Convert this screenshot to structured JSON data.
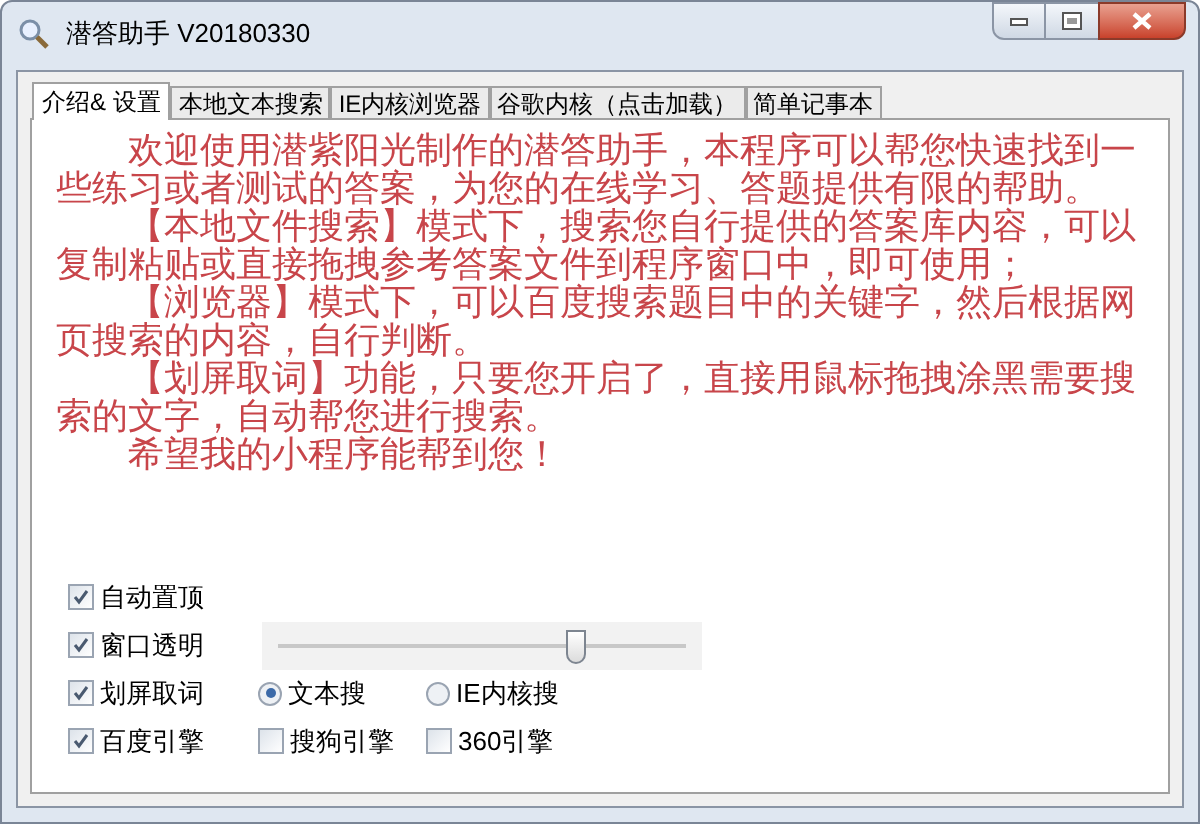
{
  "window": {
    "title": "潜答助手 V20180330"
  },
  "tabs": [
    {
      "label": "介绍& 设置",
      "selected": true
    },
    {
      "label": "本地文本搜索",
      "selected": false
    },
    {
      "label": "IE内核浏览器",
      "selected": false
    },
    {
      "label": "谷歌内核（点击加载）",
      "selected": false
    },
    {
      "label": "简单记事本",
      "selected": false
    }
  ],
  "intro": [
    "欢迎使用潜紫阳光制作的潜答助手，本程序可以帮您快速找到一些练习或者测试的答案，为您的在线学习、答题提供有限的帮助。",
    "【本地文件搜索】模式下，搜索您自行提供的答案库内容，可以复制粘贴或直接拖拽参考答案文件到程序窗口中，即可使用；",
    "【浏览器】模式下，可以百度搜索题目中的关键字，然后根据网页搜索的内容，自行判断。",
    "【划屏取词】功能，只要您开启了，直接用鼠标拖拽涂黑需要搜索的文字，自动帮您进行搜索。",
    "希望我的小程序能帮到您！"
  ],
  "settings": [
    {
      "row": [
        {
          "kind": "checkbox",
          "label": "自动置顶",
          "checked": true
        }
      ]
    },
    {
      "row": [
        {
          "kind": "checkbox",
          "label": "窗口透明",
          "checked": true
        },
        {
          "kind": "slider",
          "level": 0.73
        }
      ]
    },
    {
      "row": [
        {
          "kind": "checkbox",
          "label": "划屏取词",
          "checked": true
        },
        {
          "kind": "radio",
          "label": "文本搜",
          "selected": true
        },
        {
          "kind": "radio",
          "label": "IE内核搜",
          "selected": false
        }
      ]
    },
    {
      "row": [
        {
          "kind": "checkbox",
          "label": "百度引擎",
          "checked": true
        },
        {
          "kind": "checkbox",
          "label": "搜狗引擎",
          "checked": false
        },
        {
          "kind": "checkbox",
          "label": "360引擎",
          "checked": false
        }
      ]
    }
  ]
}
